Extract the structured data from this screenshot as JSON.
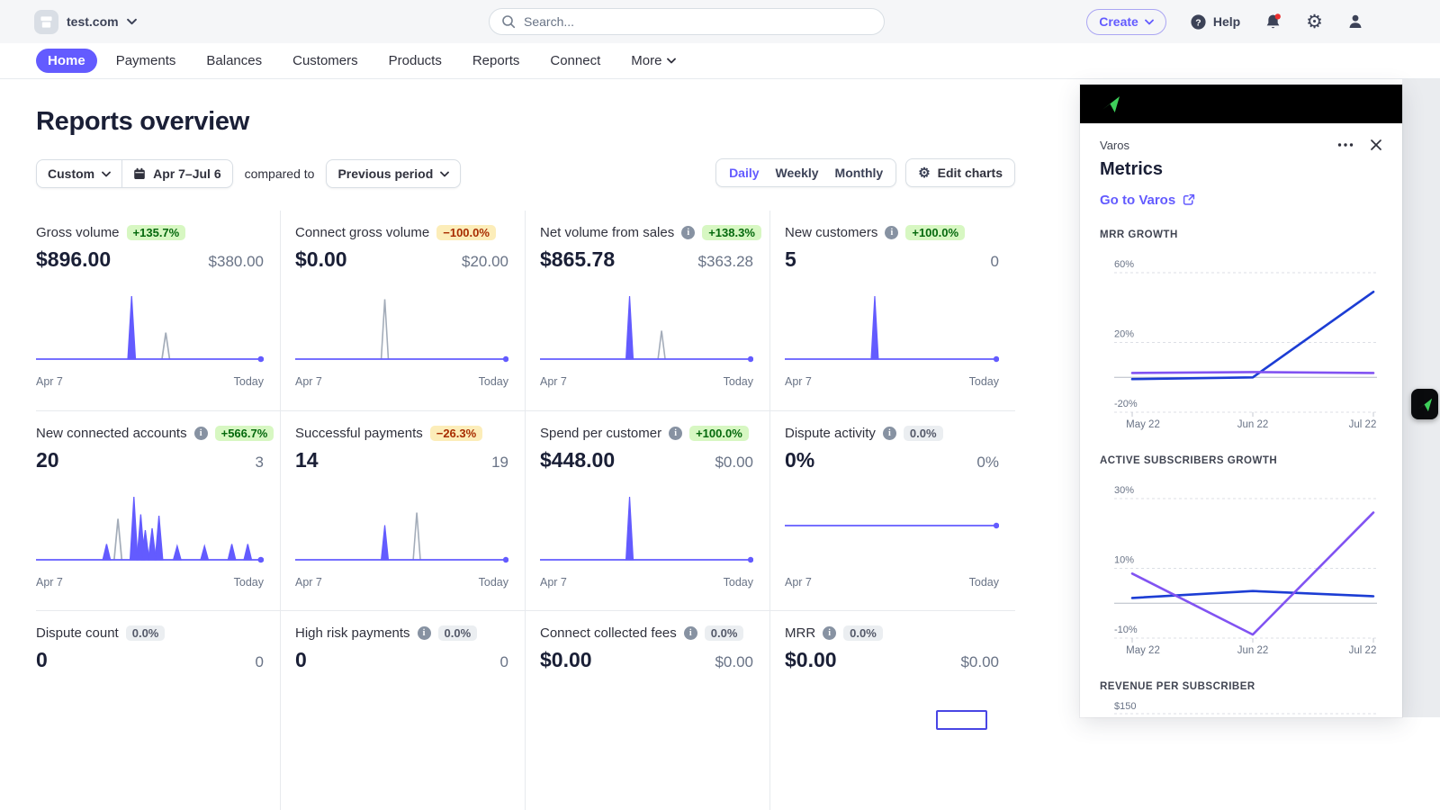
{
  "topbar": {
    "account": "test.com",
    "search_placeholder": "Search...",
    "create_label": "Create",
    "help_label": "Help"
  },
  "nav": {
    "items": [
      {
        "label": "Home",
        "active": true
      },
      {
        "label": "Payments"
      },
      {
        "label": "Balances"
      },
      {
        "label": "Customers"
      },
      {
        "label": "Products"
      },
      {
        "label": "Reports"
      },
      {
        "label": "Connect"
      },
      {
        "label": "More",
        "chevron": true
      }
    ]
  },
  "page": {
    "title": "Reports overview"
  },
  "filters": {
    "range_type": "Custom",
    "date_range": "Apr 7–Jul 6",
    "compared_to": "compared to",
    "comparison": "Previous period",
    "granularity": [
      {
        "label": "Daily",
        "active": true
      },
      {
        "label": "Weekly"
      },
      {
        "label": "Monthly"
      }
    ],
    "edit_charts_label": "Edit charts"
  },
  "sparkline_axis": {
    "start": "Apr 7",
    "end": "Today"
  },
  "colors": {
    "accent": "#635bff",
    "positive_bg": "#d7f7c2",
    "positive_text": "#05690d",
    "negative_bg": "#fcedb9",
    "negative_text": "#a82c00",
    "neutral_bg": "#ebeef1",
    "neutral_text": "#545969",
    "spark_current": "#635bff",
    "spark_previous": "#a3acb9",
    "varos_blue": "#1c3dd4",
    "varos_purple": "#8153f2",
    "varos_green": "#3ecf5a"
  },
  "cards": [
    {
      "label": "Gross volume",
      "info": false,
      "badge": "+135.7%",
      "badge_type": "positive",
      "current": "$896.00",
      "previous": "$380.00",
      "chart": {
        "spikes": [
          {
            "x": 0.42,
            "h": 1,
            "s": "current"
          },
          {
            "x": 0.57,
            "h": 0.42,
            "s": "previous"
          }
        ]
      }
    },
    {
      "label": "Connect gross volume",
      "info": false,
      "badge": "−100.0%",
      "badge_type": "negative",
      "current": "$0.00",
      "previous": "$20.00",
      "chart": {
        "spikes": [
          {
            "x": 0.42,
            "h": 0.95,
            "s": "previous"
          }
        ]
      }
    },
    {
      "label": "Net volume from sales",
      "info": true,
      "badge": "+138.3%",
      "badge_type": "positive",
      "current": "$865.78",
      "previous": "$363.28",
      "chart": {
        "spikes": [
          {
            "x": 0.42,
            "h": 1,
            "s": "current"
          },
          {
            "x": 0.57,
            "h": 0.45,
            "s": "previous"
          }
        ]
      }
    },
    {
      "label": "New customers",
      "info": true,
      "badge": "+100.0%",
      "badge_type": "positive",
      "current": "5",
      "previous": "0",
      "chart": {
        "spikes": [
          {
            "x": 0.42,
            "h": 1,
            "s": "current"
          }
        ]
      }
    },
    {
      "label": "New connected accounts",
      "info": true,
      "badge": "+566.7%",
      "badge_type": "positive",
      "current": "20",
      "previous": "3",
      "chart": {
        "spikes": [
          {
            "x": 0.31,
            "h": 0.25,
            "s": "current"
          },
          {
            "x": 0.36,
            "h": 0.65,
            "s": "previous"
          },
          {
            "x": 0.43,
            "h": 1,
            "s": "current"
          },
          {
            "x": 0.46,
            "h": 0.72,
            "s": "current"
          },
          {
            "x": 0.48,
            "h": 0.47,
            "s": "current"
          },
          {
            "x": 0.51,
            "h": 0.5,
            "s": "current"
          },
          {
            "x": 0.54,
            "h": 0.7,
            "s": "current"
          },
          {
            "x": 0.62,
            "h": 0.22,
            "s": "current"
          },
          {
            "x": 0.74,
            "h": 0.22,
            "s": "current"
          },
          {
            "x": 0.86,
            "h": 0.25,
            "s": "current"
          },
          {
            "x": 0.93,
            "h": 0.25,
            "s": "current"
          }
        ]
      }
    },
    {
      "label": "Successful payments",
      "info": false,
      "badge": "−26.3%",
      "badge_type": "negative",
      "current": "14",
      "previous": "19",
      "chart": {
        "spikes": [
          {
            "x": 0.42,
            "h": 0.55,
            "s": "current"
          },
          {
            "x": 0.57,
            "h": 0.75,
            "s": "previous"
          }
        ]
      }
    },
    {
      "label": "Spend per customer",
      "info": true,
      "badge": "+100.0%",
      "badge_type": "positive",
      "current": "$448.00",
      "previous": "$0.00",
      "chart": {
        "spikes": [
          {
            "x": 0.42,
            "h": 1,
            "s": "current"
          }
        ]
      }
    },
    {
      "label": "Dispute activity",
      "info": true,
      "badge": "0.0%",
      "badge_type": "neutral",
      "current": "0%",
      "previous": "0%",
      "chart": {
        "spikes": [],
        "base": "mid"
      }
    },
    {
      "label": "Dispute count",
      "info": false,
      "badge": "0.0%",
      "badge_type": "neutral",
      "current": "0",
      "previous": "0",
      "chart": null
    },
    {
      "label": "High risk payments",
      "info": true,
      "badge": "0.0%",
      "badge_type": "neutral",
      "current": "0",
      "previous": "0",
      "chart": null
    },
    {
      "label": "Connect collected fees",
      "info": true,
      "badge": "0.0%",
      "badge_type": "neutral",
      "current": "$0.00",
      "previous": "$0.00",
      "chart": null
    },
    {
      "label": "MRR",
      "info": true,
      "badge": "0.0%",
      "badge_type": "neutral",
      "current": "$0.00",
      "previous": "$0.00",
      "chart": null
    }
  ],
  "varos": {
    "app_name": "Varos",
    "heading": "Metrics",
    "link_label": "Go to Varos",
    "charts": [
      {
        "title": "MRR GROWTH",
        "y_ticks": [
          {
            "label": "60%",
            "value": 60
          },
          {
            "label": "20%",
            "value": 20
          },
          {
            "label": "-20%",
            "value": -20
          }
        ],
        "x_labels": [
          "May 22",
          "Jun 22",
          "Jul 22"
        ],
        "series": [
          {
            "name": "blue",
            "color": "#1c3dd4",
            "values": [
              -1,
              0,
              49
            ]
          },
          {
            "name": "purple",
            "color": "#8153f2",
            "values": [
              2.5,
              3,
              2.5
            ]
          }
        ]
      },
      {
        "title": "ACTIVE SUBSCRIBERS GROWTH",
        "y_ticks": [
          {
            "label": "30%",
            "value": 30
          },
          {
            "label": "10%",
            "value": 10
          },
          {
            "label": "-10%",
            "value": -10
          }
        ],
        "x_labels": [
          "May 22",
          "Jun 22",
          "Jul 22"
        ],
        "series": [
          {
            "name": "blue",
            "color": "#1c3dd4",
            "values": [
              1.5,
              3.5,
              2
            ]
          },
          {
            "name": "purple",
            "color": "#8153f2",
            "values": [
              8.5,
              -9,
              26
            ]
          }
        ]
      },
      {
        "title": "REVENUE PER SUBSCRIBER",
        "y_ticks": [
          {
            "label": "$150",
            "value": 150
          }
        ],
        "x_labels": [],
        "series": [],
        "cut": true
      }
    ]
  },
  "chart_data": [
    {
      "type": "line",
      "title": "MRR GROWTH",
      "x": [
        "May 22",
        "Jun 22",
        "Jul 22"
      ],
      "series": [
        {
          "name": "blue",
          "values": [
            -1,
            0,
            49
          ]
        },
        {
          "name": "purple",
          "values": [
            2.5,
            3,
            2.5
          ]
        }
      ],
      "ylabel": "%",
      "ylim": [
        -32,
        72
      ],
      "y_ticks": [
        "60%",
        "20%",
        "-20%"
      ],
      "grid": "dashed"
    },
    {
      "type": "line",
      "title": "ACTIVE SUBSCRIBERS GROWTH",
      "x": [
        "May 22",
        "Jun 22",
        "Jul 22"
      ],
      "series": [
        {
          "name": "blue",
          "values": [
            1.5,
            3.5,
            2
          ]
        },
        {
          "name": "purple",
          "values": [
            8.5,
            -9,
            26
          ]
        }
      ],
      "ylabel": "%",
      "ylim": [
        -16,
        36
      ],
      "y_ticks": [
        "30%",
        "10%",
        "-10%"
      ],
      "grid": "dashed"
    }
  ]
}
